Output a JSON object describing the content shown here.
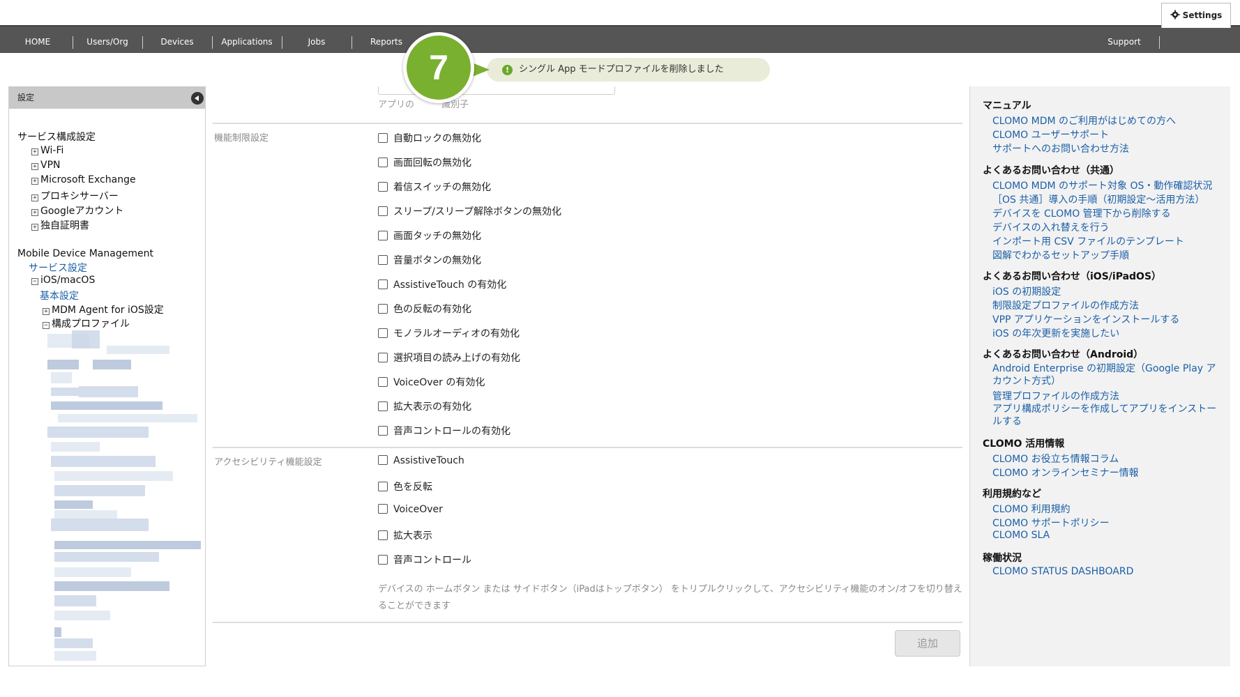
{
  "nav": {
    "items": [
      "HOME",
      "Users/Org",
      "Devices",
      "Applications",
      "Jobs",
      "Reports"
    ],
    "support": "Support",
    "settings": "Settings"
  },
  "toast": {
    "step": "7",
    "message": "シングル App モードプロファイルを削除しました"
  },
  "sidebar": {
    "title": "設定",
    "service_config": "サービス構成設定",
    "service_items": [
      "Wi-Fi",
      "VPN",
      "Microsoft Exchange",
      "プロキシサーバー",
      "Googleアカウント",
      "独自証明書"
    ],
    "mdm": "Mobile Device Management",
    "service_settings": "サービス設定",
    "ios_macos": "iOS/macOS",
    "basic_settings": "基本設定",
    "mdm_agent": "MDM Agent for iOS設定",
    "config_profile": "構成プロファイル"
  },
  "main": {
    "app_hint": "アプリの　　　識別子",
    "restriction_label": "機能制限設定",
    "restrictions": [
      "自動ロックの無効化",
      "画面回転の無効化",
      "着信スイッチの無効化",
      "スリープ/スリープ解除ボタンの無効化",
      "画面タッチの無効化",
      "音量ボタンの無効化",
      "AssistiveTouch の有効化",
      "色の反転の有効化",
      "モノラルオーディオの有効化",
      "選択項目の読み上げの有効化",
      "VoiceOver の有効化",
      "拡大表示の有効化",
      "音声コントロールの有効化"
    ],
    "accessibility_label": "アクセシビリティ機能設定",
    "accessibility": [
      "AssistiveTouch",
      "色を反転",
      "VoiceOver",
      "拡大表示",
      "音声コントロール"
    ],
    "accessibility_note": "デバイスの ホームボタン または サイドボタン（iPadはトップボタン） をトリプルクリックして、アクセシビリティ機能のオン/オフを切り替えることができます",
    "add_button": "追加"
  },
  "right": {
    "sections": [
      {
        "title": "マニュアル",
        "links": [
          "CLOMO MDM のご利用がはじめての方へ",
          "CLOMO ユーザーサポート",
          "サポートへのお問い合わせ方法"
        ]
      },
      {
        "title": "よくあるお問い合わせ（共通）",
        "links": [
          "CLOMO MDM のサポート対象 OS・動作確認状況",
          "［OS 共通］導入の手順（初期設定〜活用方法）",
          "デバイスを CLOMO 管理下から削除する",
          "デバイスの入れ替えを行う",
          "インポート用 CSV ファイルのテンプレート",
          "図解でわかるセットアップ手順"
        ]
      },
      {
        "title": "よくあるお問い合わせ（iOS/iPadOS）",
        "links": [
          "iOS の初期設定",
          "制限設定プロファイルの作成方法",
          "VPP アプリケーションをインストールする",
          "iOS の年次更新を実施したい"
        ]
      },
      {
        "title": "よくあるお問い合わせ（Android）",
        "links": [
          "Android Enterprise の初期設定（Google Play アカウント方式）",
          "管理プロファイルの作成方法",
          "アプリ構成ポリシーを作成してアプリをインストールする"
        ]
      },
      {
        "title": "CLOMO 活用情報",
        "links": [
          "CLOMO お役立ち情報コラム",
          "CLOMO オンラインセミナー情報"
        ]
      },
      {
        "title": "利用規約など",
        "links": [
          "CLOMO 利用規約",
          "CLOMO サポートポリシー",
          "CLOMO SLA"
        ]
      },
      {
        "title": "稼働状況",
        "links": [
          "CLOMO STATUS DASHBOARD"
        ]
      }
    ]
  }
}
